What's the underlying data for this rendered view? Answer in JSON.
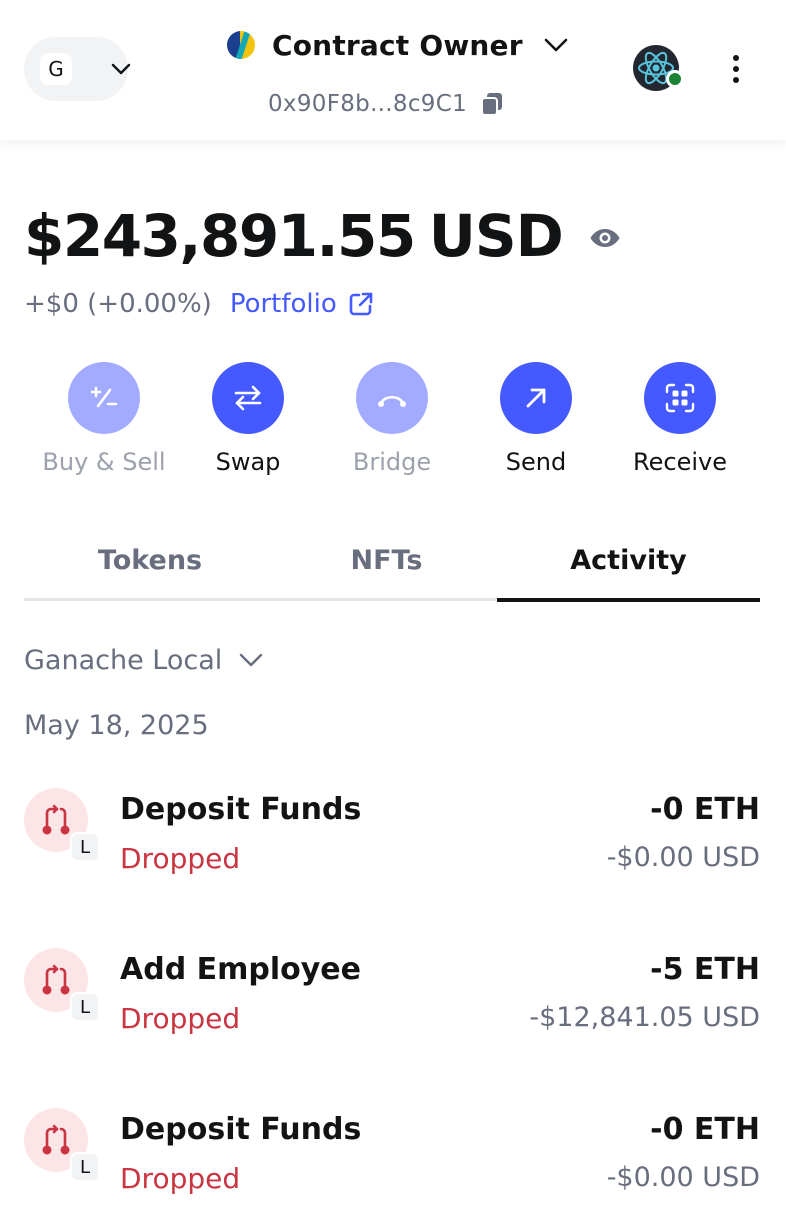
{
  "header": {
    "network_initial": "G",
    "account_name": "Contract Owner",
    "account_address": "0x90F8b...8c9C1"
  },
  "balance": {
    "amount": "$243,891.55",
    "currency": "USD",
    "change": "+$0 (+0.00%)",
    "portfolio_label": "Portfolio"
  },
  "actions": [
    {
      "label": "Buy & Sell",
      "icon": "plus-minus-icon",
      "enabled": false
    },
    {
      "label": "Swap",
      "icon": "swap-arrows-icon",
      "enabled": true
    },
    {
      "label": "Bridge",
      "icon": "bridge-icon",
      "enabled": false
    },
    {
      "label": "Send",
      "icon": "arrow-up-right-icon",
      "enabled": true
    },
    {
      "label": "Receive",
      "icon": "qr-code-icon",
      "enabled": true
    }
  ],
  "tabs": [
    {
      "label": "Tokens",
      "active": false
    },
    {
      "label": "NFTs",
      "active": false
    },
    {
      "label": "Activity",
      "active": true
    }
  ],
  "activity": {
    "network_filter": "Ganache Local",
    "date": "May 18, 2025",
    "transactions": [
      {
        "title": "Deposit Funds",
        "status": "Dropped",
        "amount": "-0 ETH",
        "fiat": "-$0.00 USD",
        "network_badge": "L"
      },
      {
        "title": "Add Employee",
        "status": "Dropped",
        "amount": "-5 ETH",
        "fiat": "-$12,841.05 USD",
        "network_badge": "L"
      },
      {
        "title": "Deposit Funds",
        "status": "Dropped",
        "amount": "-0 ETH",
        "fiat": "-$0.00 USD",
        "network_badge": "L"
      }
    ]
  },
  "colors": {
    "primary": "#4459ff",
    "primary_disabled": "#a2abff",
    "error": "#ca3542",
    "success": "#1c8234",
    "muted_text": "#686e7d"
  }
}
